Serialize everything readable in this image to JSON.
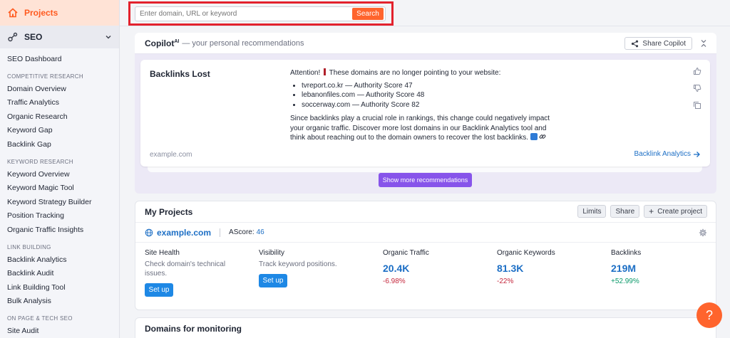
{
  "sidebar": {
    "projects_label": "Projects",
    "seo_label": "SEO",
    "seo_dashboard": "SEO Dashboard",
    "sections": [
      {
        "title": "COMPETITIVE RESEARCH",
        "items": [
          "Domain Overview",
          "Traffic Analytics",
          "Organic Research",
          "Keyword Gap",
          "Backlink Gap"
        ]
      },
      {
        "title": "KEYWORD RESEARCH",
        "items": [
          "Keyword Overview",
          "Keyword Magic Tool",
          "Keyword Strategy Builder",
          "Position Tracking",
          "Organic Traffic Insights"
        ]
      },
      {
        "title": "LINK BUILDING",
        "items": [
          "Backlink Analytics",
          "Backlink Audit",
          "Link Building Tool",
          "Bulk Analysis"
        ]
      },
      {
        "title": "ON PAGE & TECH SEO",
        "items": [
          "Site Audit"
        ]
      }
    ]
  },
  "search": {
    "placeholder": "Enter domain, URL or keyword",
    "button_label": "Search"
  },
  "copilot": {
    "title": "Copilot",
    "title_sup": "AI",
    "subtitle": "— your personal recommendations",
    "share_label": "Share Copilot",
    "card": {
      "title": "Backlinks Lost",
      "attention_prefix": "Attention!",
      "attention_text": "These domains are no longer pointing to your website:",
      "lost_domains": [
        "tvreport.co.kr — Authority Score 47",
        "lebanonfiles.com — Authority Score 48",
        "soccerway.com — Authority Score 82"
      ],
      "paragraph": "Since backlinks play a crucial role in rankings, this change could negatively impact your organic traffic. Discover more lost domains in our Backlink Analytics tool and think about reaching out to the domain owners to recover the lost backlinks.",
      "domain": "example.com",
      "link_label": "Backlink Analytics"
    },
    "show_more_label": "Show more recommendations"
  },
  "projects": {
    "title": "My Projects",
    "limits_label": "Limits",
    "share_label": "Share",
    "create_label": "Create project",
    "site": {
      "name": "example.com",
      "ascore_label": "AScore:",
      "ascore_value": "46"
    },
    "site_health": {
      "label": "Site Health",
      "desc": "Check domain's technical issues.",
      "button": "Set up"
    },
    "visibility": {
      "label": "Visibility",
      "desc": "Track keyword positions.",
      "button": "Set up"
    },
    "organic_traffic": {
      "label": "Organic Traffic",
      "value": "20.4K",
      "change": "-6.98%"
    },
    "organic_keywords": {
      "label": "Organic Keywords",
      "value": "81.3K",
      "change": "-22%"
    },
    "backlinks": {
      "label": "Backlinks",
      "value": "219M",
      "change": "+52.99%"
    }
  },
  "domains": {
    "title": "Domains for monitoring"
  },
  "help": {
    "label": "?"
  },
  "colors": {
    "accent": "#ff642d",
    "link": "#1d6fc5",
    "purple": "#8754ea",
    "negative": "#c5283d",
    "positive": "#0b9a6a",
    "highlight": "#e3222d"
  }
}
